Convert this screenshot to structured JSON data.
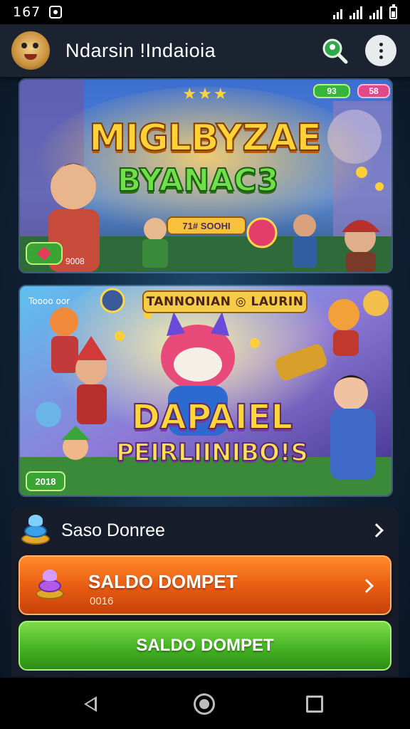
{
  "status_bar": {
    "time": "167"
  },
  "app_bar": {
    "title": "Ndarsin !Indaioia"
  },
  "banner1": {
    "stars": "★★★",
    "badge_left": "93",
    "badge_right": "58",
    "title_line1": "MIGLBYZAE",
    "title_line2": "BYANAC3",
    "tag": "71# SOOHI",
    "bottom_label": "9008"
  },
  "banner2": {
    "corner_text": "Toooo oor",
    "ribbon": "TANNONIAN ◎ LAURIN",
    "title_line1": "DAPAIEL",
    "title_line2": "PEIRLIINIBO!S",
    "bottom_badge": "2018"
  },
  "saldo_row": {
    "label": "Saso Donree"
  },
  "orange_button": {
    "title": "SALDO DOMPET",
    "subtitle": "0016"
  },
  "green_button": {
    "label": "SALDO DOMPET"
  },
  "colors": {
    "orange": "#e75a12",
    "green": "#45b324",
    "app_bar": "#1c2330"
  }
}
